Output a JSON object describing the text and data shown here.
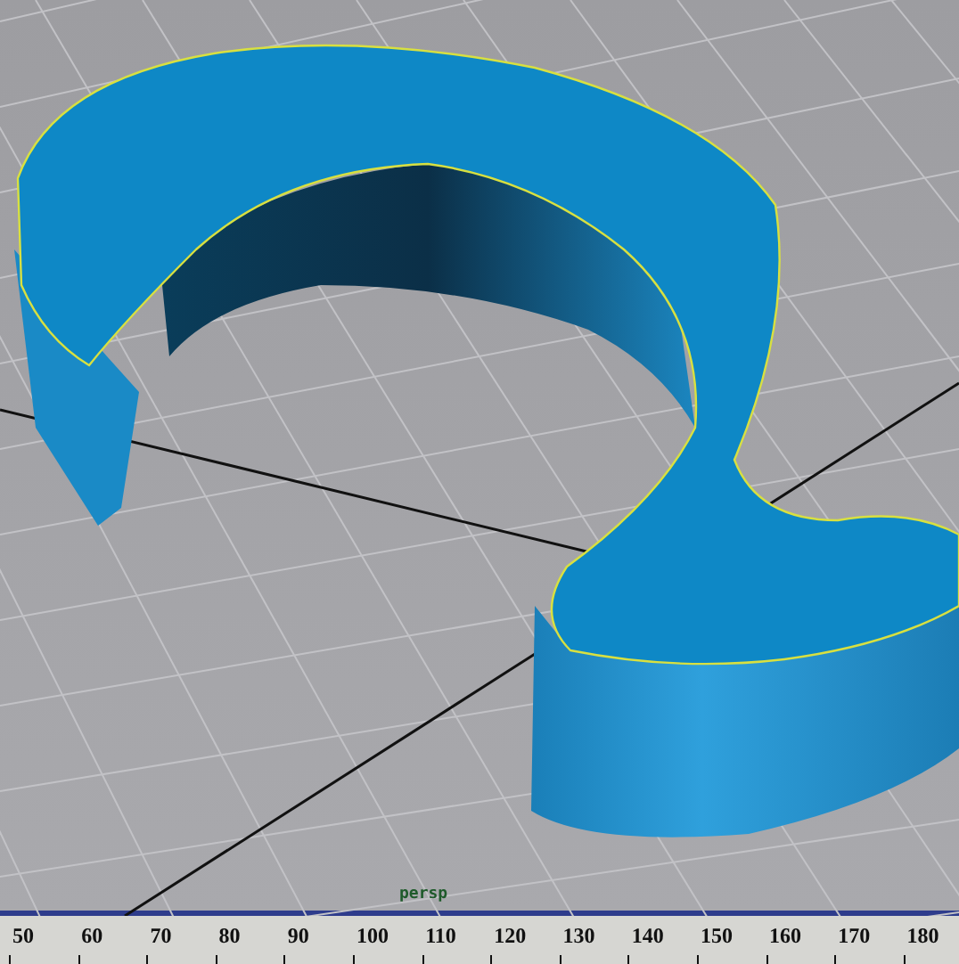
{
  "viewport": {
    "camera_label": "persp"
  },
  "time_slider": {
    "frames": [
      "50",
      "60",
      "70",
      "80",
      "90",
      "100",
      "110",
      "120",
      "130",
      "140",
      "150",
      "160",
      "170",
      "180"
    ]
  }
}
